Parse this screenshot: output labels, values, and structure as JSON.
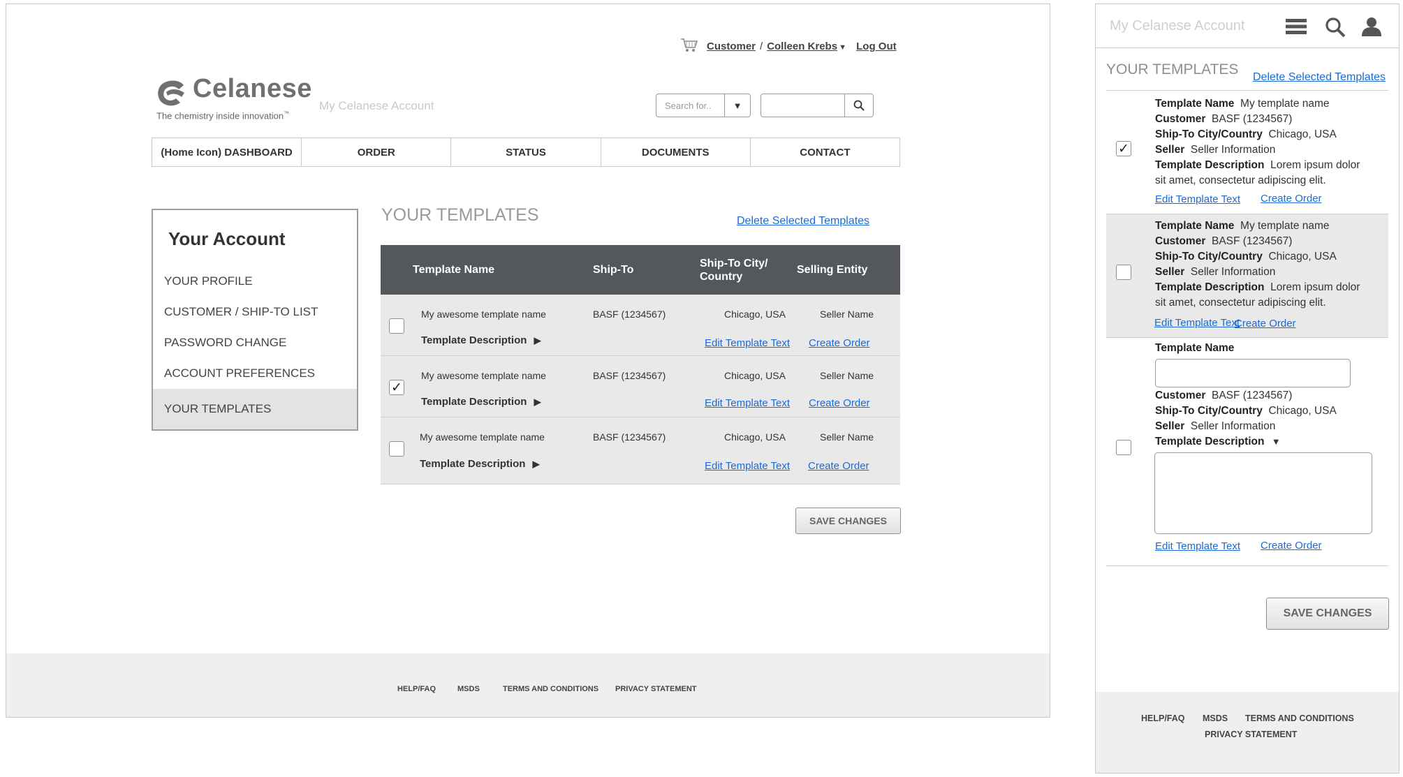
{
  "desktop": {
    "topbar": {
      "customer": "Customer",
      "separator": "/",
      "user": "Colleen Krebs",
      "logout": "Log Out"
    },
    "brand": {
      "name": "Celanese",
      "tagline": "The chemistry inside innovation",
      "tagline_mark": "™",
      "site": "My Celanese Account"
    },
    "search": {
      "select_placeholder": "Search for..",
      "input_placeholder": ""
    },
    "nav": [
      "(Home Icon) DASHBOARD",
      "ORDER",
      "STATUS",
      "DOCUMENTS",
      "CONTACT"
    ],
    "account": {
      "title": "Your Account",
      "items": [
        "YOUR PROFILE",
        "CUSTOMER / SHIP-TO LIST",
        "PASSWORD CHANGE",
        "ACCOUNT PREFERENCES",
        "YOUR TEMPLATES"
      ],
      "active_index": 4
    },
    "templates": {
      "title": "YOUR TEMPLATES",
      "delete_link": "Delete Selected Templates",
      "columns": {
        "name": "Template Name",
        "shipto": "Ship-To",
        "city_line1": "Ship-To City/",
        "city_line2": "Country",
        "entity": "Selling Entity"
      },
      "rows": [
        {
          "checked": false,
          "name": "My awesome template name",
          "description": "Template Description",
          "shipto": "BASF (1234567)",
          "city": "Chicago, USA",
          "entity": "Seller Name",
          "edit": "Edit Template Text",
          "create": "Create Order"
        },
        {
          "checked": true,
          "name": "My awesome template name",
          "description": "Template Description",
          "shipto": "BASF (1234567)",
          "city": "Chicago, USA",
          "entity": "Seller Name",
          "edit": "Edit Template Text",
          "create": "Create Order"
        },
        {
          "checked": false,
          "name": "My awesome template name",
          "description": "Template Description",
          "shipto": "BASF (1234567)",
          "city": "Chicago, USA",
          "entity": "Seller Name",
          "edit": "Edit Template Text",
          "create": "Create Order"
        }
      ],
      "save": "SAVE CHANGES"
    },
    "footer": [
      "HELP/FAQ",
      "MSDS",
      "TERMS AND CONDITIONS",
      "PRIVACY STATEMENT"
    ]
  },
  "mobile": {
    "header_title": "My Celanese Account",
    "title": "YOUR TEMPLATES",
    "delete_link": "Delete Selected Templates",
    "labels": {
      "name": "Template Name",
      "customer": "Customer",
      "city": "Ship-To City/Country",
      "seller": "Seller",
      "description": "Template Description"
    },
    "records": [
      {
        "checked": true,
        "name": "My template name",
        "customer": "BASF (1234567)",
        "city": "Chicago, USA",
        "seller": "Seller Information",
        "desc_line1": "Lorem ipsum dolor",
        "desc_line2": "sit amet, consectetur adipiscing elit.",
        "edit": "Edit Template Text",
        "create": "Create Order"
      },
      {
        "checked": false,
        "name": "My template name",
        "customer": "BASF (1234567)",
        "city": "Chicago, USA",
        "seller": "Seller Information",
        "desc_line1": "Lorem ipsum dolor",
        "desc_line2": "sit amet, consectetur adipiscing elit.",
        "edit": "Edit Template Text",
        "create": "Create Order"
      },
      {
        "checked": false,
        "name": "",
        "customer": "BASF (1234567)",
        "city": "Chicago, USA",
        "seller": "Seller Information",
        "description": "",
        "edit": "Edit Template Text",
        "create": "Create Order"
      }
    ],
    "save": "SAVE CHANGES",
    "footer": {
      "line1": [
        "HELP/FAQ",
        "MSDS",
        "TERMS AND CONDITIONS"
      ],
      "line2": [
        "PRIVACY STATEMENT"
      ]
    }
  },
  "colors": {
    "table_header": "#54575b",
    "link": "#1a6bd6",
    "row_bg": "#e9e9e9",
    "footer_bg": "#efefef",
    "logo": "#707070"
  }
}
